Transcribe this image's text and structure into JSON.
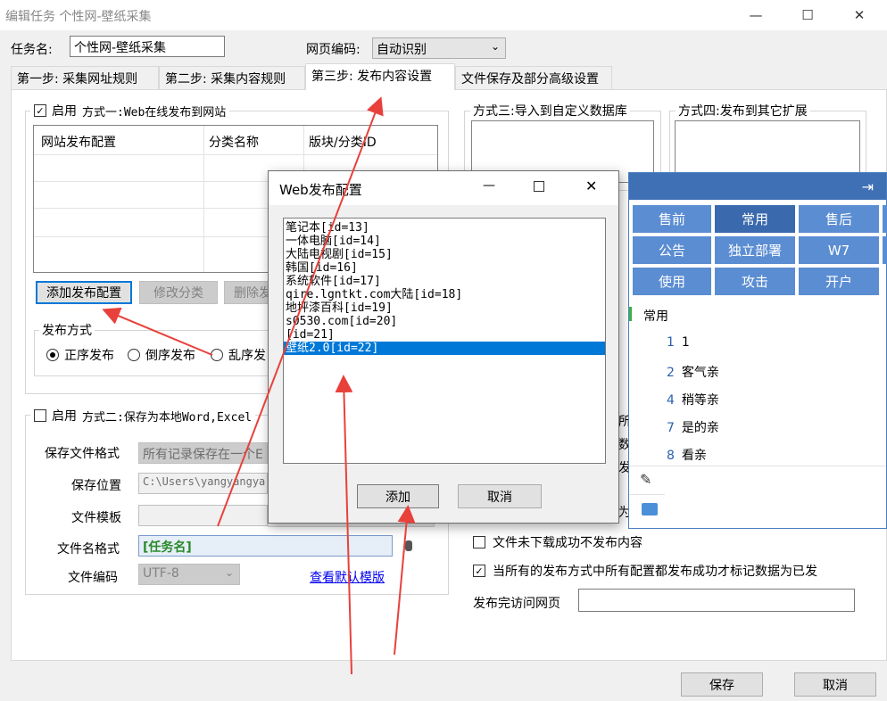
{
  "window": {
    "title": "编辑任务 个性网-壁纸采集",
    "minimize": "—",
    "maximize": "☐",
    "close": "✕"
  },
  "task": {
    "name_label": "任务名:",
    "name_value": "个性网-壁纸采集",
    "encoding_label": "网页编码:",
    "encoding_value": "自动识别"
  },
  "tabs": [
    {
      "label": "第一步: 采集网址规则"
    },
    {
      "label": "第二步: 采集内容规则"
    },
    {
      "label": "第三步: 发布内容设置"
    },
    {
      "label": "文件保存及部分高级设置"
    }
  ],
  "method1": {
    "enable_label": "启用",
    "title": "方式一:Web在线发布到网站",
    "columns": [
      "网站发布配置",
      "分类名称",
      "版块/分类ID"
    ],
    "add_button": "添加发布配置",
    "edit_button": "修改分类",
    "delete_button": "删除发",
    "publish_mode_label": "发布方式",
    "modes": [
      "正序发布",
      "倒序发布",
      "乱序发"
    ]
  },
  "method2": {
    "enable_label": "启用",
    "title": "方式二:保存为本地Word,Excel",
    "format_label": "保存文件格式",
    "format_value": "所有记录保存在一个E",
    "location_label": "保存位置",
    "location_value": "C:\\Users\\yangyangya",
    "template_label": "文件模板",
    "template_value": "",
    "filename_label": "文件名格式",
    "filename_value": "[任务名]",
    "encoding_label": "文件编码",
    "encoding_value": "UTF-8",
    "view_template_link": "查看默认模版"
  },
  "method3": {
    "title": "方式三:导入到自定义数据库"
  },
  "method4": {
    "title": "方式四:发布到其它扩展"
  },
  "options": {
    "no_publish_label": "文件未下载成功不发布内容",
    "mark_label": "当所有的发布方式中所有配置都发布成功才标记数据为已发",
    "visit_label": "发布完访问网页",
    "visit_value": "",
    "partial": [
      "所",
      "数",
      "发",
      "为"
    ]
  },
  "footer": {
    "save": "保存",
    "cancel": "取消"
  },
  "dialog": {
    "title": "Web发布配置",
    "items": [
      "笔记本[id=13]",
      "一体电脑[id=14]",
      "大陆电视剧[id=15]",
      "韩国[id=16]",
      "系统软件[id=17]",
      "qire.lgntkt.com大陆[id=18]",
      "地坪漆百科[id=19]",
      "s0530.com[id=20]",
      "[id=21]",
      "壁纸2.0[id=22]"
    ],
    "selected_index": 9,
    "add_button": "添加",
    "cancel_button": "取消"
  },
  "ime": {
    "row1": [
      "售前",
      "常用",
      "售后"
    ],
    "row2": [
      "公告",
      "独立部署",
      "W7"
    ],
    "row3": [
      "使用",
      "攻击",
      "开户"
    ],
    "section": "常用",
    "candidates": [
      {
        "num": "1",
        "text": "1"
      },
      {
        "num": "2",
        "text": "客气亲"
      },
      {
        "num": "4",
        "text": "稍等亲"
      },
      {
        "num": "7",
        "text": "是的亲"
      },
      {
        "num": "8",
        "text": "看亲"
      }
    ]
  }
}
